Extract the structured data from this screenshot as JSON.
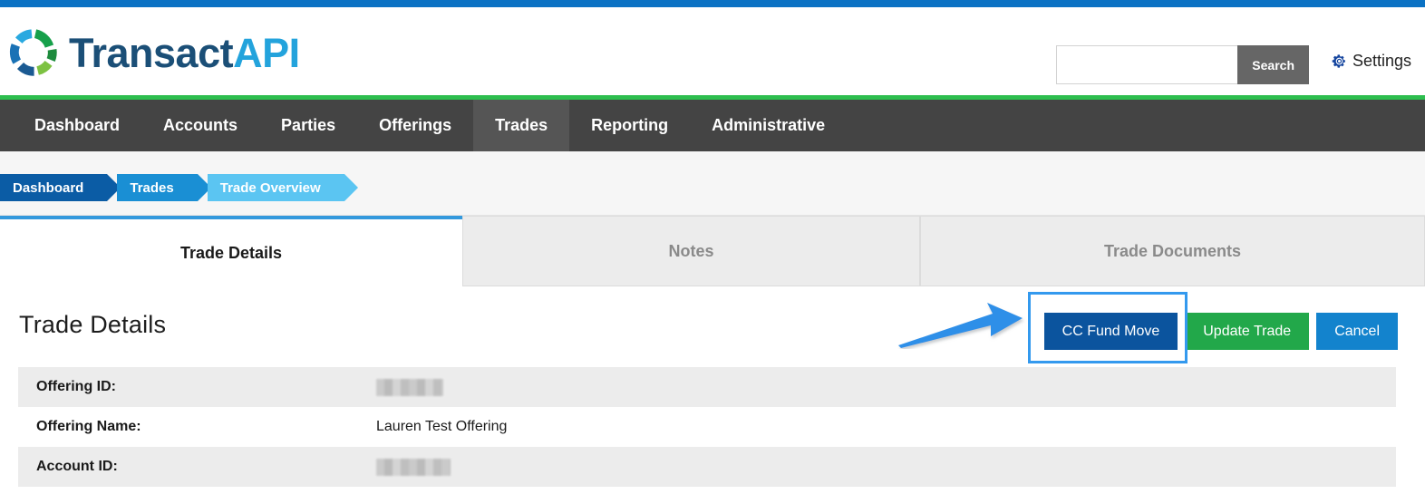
{
  "brand": {
    "name_dark": "Transact",
    "name_light": "API",
    "logo_icon": "segmented-circle-logo",
    "accent_blue": "#0b72c4",
    "accent_green": "#2dbe4e"
  },
  "header": {
    "search": {
      "value": "",
      "placeholder": "",
      "button_label": "Search",
      "icon": "search-icon"
    },
    "settings": {
      "label": "Settings",
      "icon": "gear-icon",
      "icon_color": "#14449e"
    }
  },
  "nav": {
    "items": [
      {
        "label": "Dashboard",
        "active": false
      },
      {
        "label": "Accounts",
        "active": false
      },
      {
        "label": "Parties",
        "active": false
      },
      {
        "label": "Offerings",
        "active": false
      },
      {
        "label": "Trades",
        "active": true
      },
      {
        "label": "Reporting",
        "active": false
      },
      {
        "label": "Administrative",
        "active": false
      }
    ]
  },
  "breadcrumb": {
    "items": [
      {
        "label": "Dashboard",
        "color": "#0b5ca5"
      },
      {
        "label": "Trades",
        "color": "#1a8fd4"
      },
      {
        "label": "Trade Overview",
        "color": "#5bc5f2"
      }
    ]
  },
  "tabs": [
    {
      "label": "Trade Details",
      "active": true
    },
    {
      "label": "Notes",
      "active": false
    },
    {
      "label": "Trade Documents",
      "active": false
    }
  ],
  "main": {
    "title": "Trade Details",
    "buttons": [
      {
        "label": "CC Fund Move",
        "color": "#0b549e",
        "highlighted": true
      },
      {
        "label": "Update Trade",
        "color": "#22a84a",
        "highlighted": false
      },
      {
        "label": "Cancel",
        "color": "#1383cd",
        "highlighted": false
      }
    ],
    "rows": [
      {
        "label": "Offering ID:",
        "value": "",
        "redacted": true
      },
      {
        "label": "Offering Name:",
        "value": "Lauren Test Offering",
        "redacted": false
      },
      {
        "label": "Account ID:",
        "value": "",
        "redacted": true
      }
    ]
  },
  "annotations": {
    "highlight_color": "#3399ee",
    "arrow": "right-pointing-arrow",
    "target": "CC Fund Move"
  }
}
